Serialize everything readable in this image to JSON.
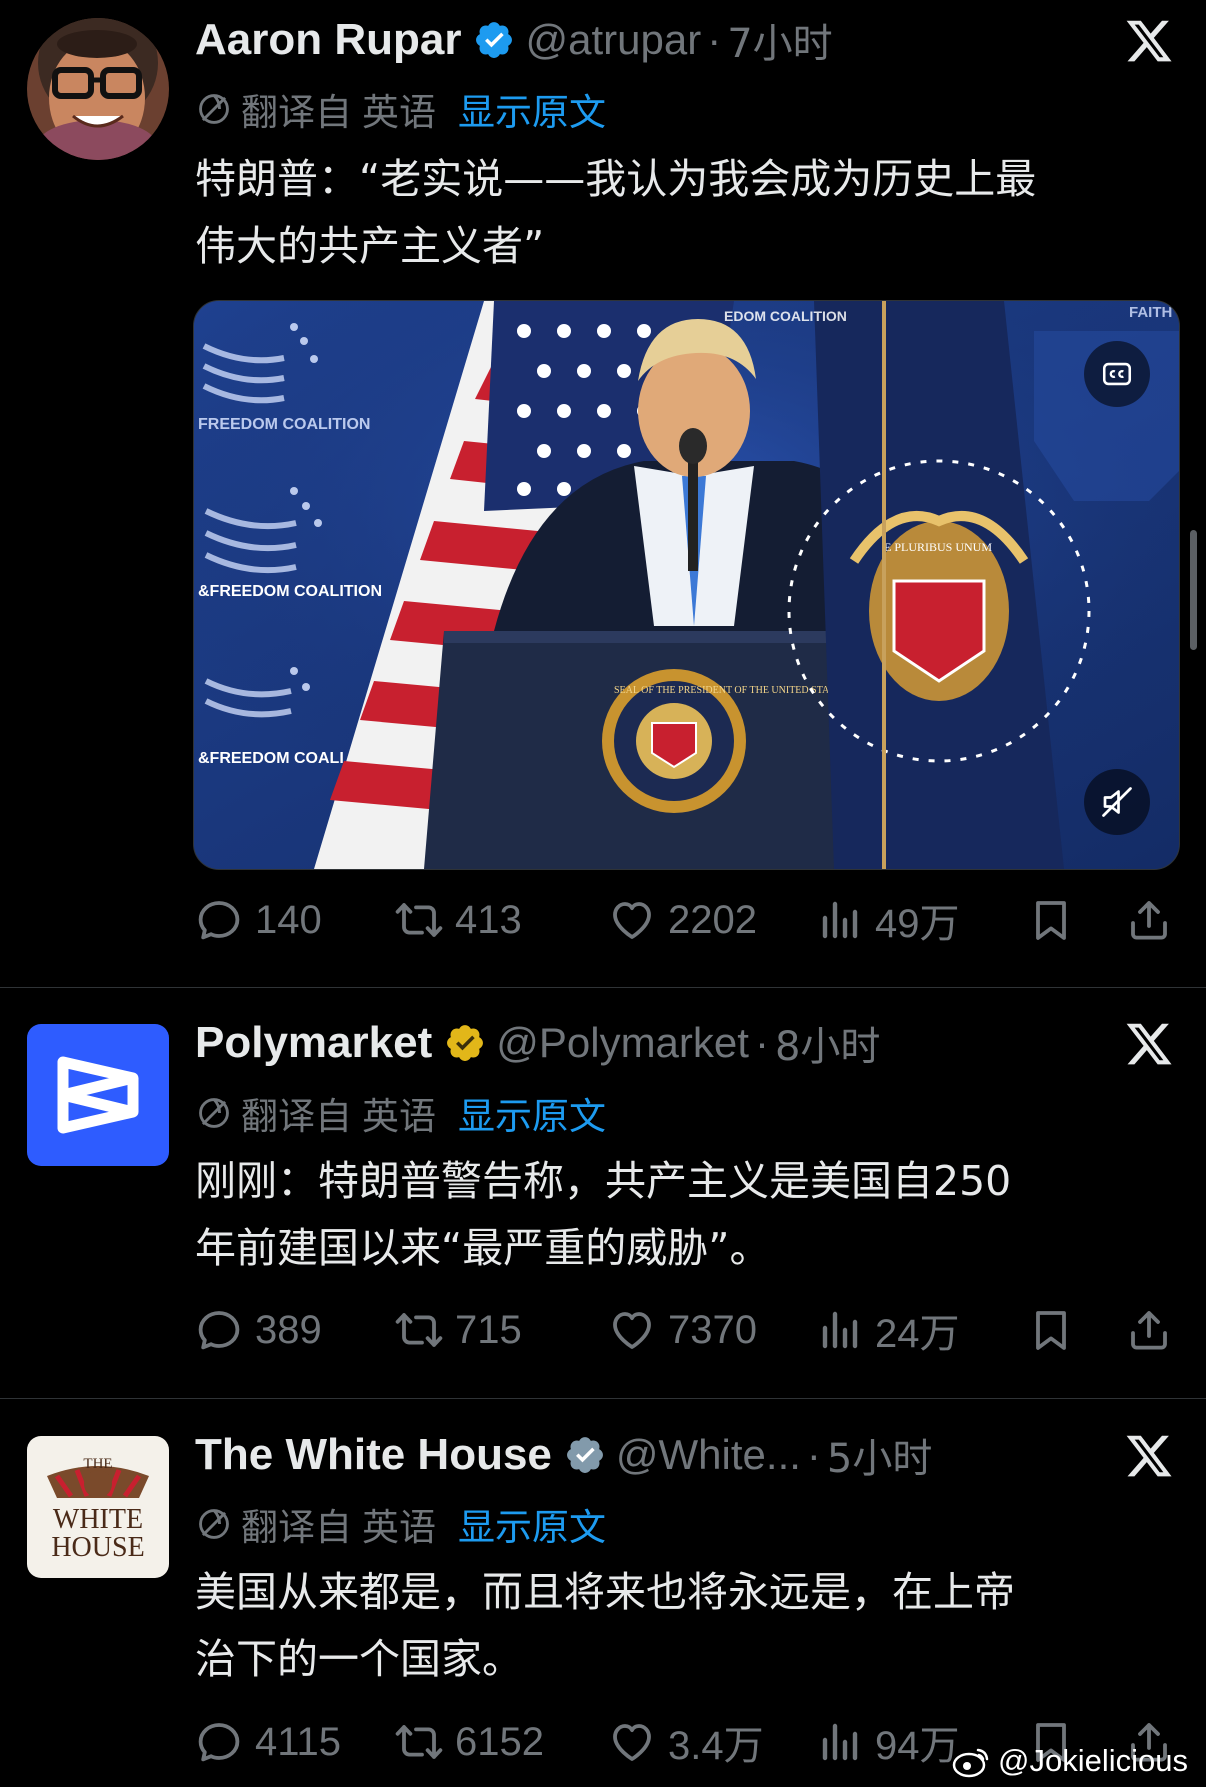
{
  "tweets": [
    {
      "name": "Aaron Rupar",
      "handle": "@atrupar",
      "separator": "·",
      "time": "7小时",
      "verified": "blue",
      "translate_label": "翻译自",
      "translate_lang": "英语",
      "show_original": "显示原文",
      "text_line1": "特朗普：“老实说——我认为我会成为历史上最",
      "text_line2": "伟大的共产主义者”",
      "media": {
        "type": "video",
        "captions_icon": "cc-icon",
        "mute_icon": "mute-icon"
      },
      "replies": "140",
      "retweets": "413",
      "likes": "2202",
      "views": "49万"
    },
    {
      "name": "Polymarket",
      "handle": "@Polymarket",
      "separator": "·",
      "time": "8小时",
      "verified": "gold",
      "translate_label": "翻译自",
      "translate_lang": "英语",
      "show_original": "显示原文",
      "text_line1": "刚刚：特朗普警告称，共产主义是美国自250",
      "text_line2": "年前建国以来“最严重的威胁”。",
      "replies": "389",
      "retweets": "715",
      "likes": "7370",
      "views": "24万"
    },
    {
      "name": "The White House",
      "handle": "@White...",
      "separator": "·",
      "time": "5小时",
      "verified": "grey",
      "avatar_text_1": "THE",
      "avatar_text_2": "WHITE",
      "avatar_text_3": "HOUSE",
      "translate_label": "翻译自",
      "translate_lang": "英语",
      "show_original": "显示原文",
      "text_line1": "美国从来都是，而且将来也将永远是，在上帝",
      "text_line2": "治下的一个国家。",
      "replies": "4115",
      "retweets": "6152",
      "likes": "3.4万",
      "views": "94万"
    }
  ],
  "video_frame": {
    "backdrop_text_1": "FREEDOM COALITION",
    "backdrop_text_2": "&FREEDOM COALITION",
    "backdrop_text_3": "&FREEDOM COALI",
    "backdrop_text_4": "FAITH",
    "seal_text": "SEAL OF THE PRESIDENT OF THE UNITED STATES",
    "flag_text": "E PLURIBUS UNUM"
  },
  "watermark": "@Jokielicious",
  "colors": {
    "background": "#000000",
    "text": "#e7e9ea",
    "muted": "#71767b",
    "link": "#1d9bf0",
    "verified_blue": "#1d9bf0",
    "verified_gold": "#e2b719",
    "verified_grey": "#829aab",
    "polymarket_blue": "#2e5cff"
  }
}
